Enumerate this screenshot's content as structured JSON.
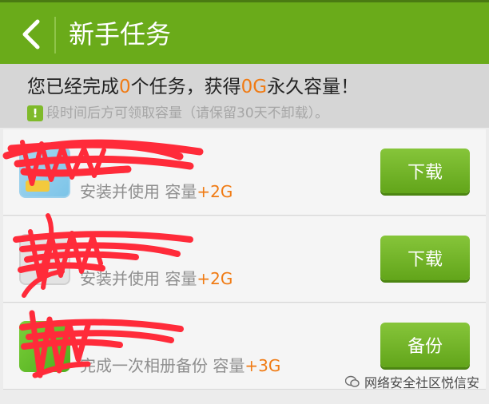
{
  "header": {
    "title": "新手任务",
    "back_icon": "chevron-left-icon"
  },
  "summary": {
    "prefix": "您已经完成",
    "completed_count": "0",
    "mid": "个任务，获得",
    "earned": "0G",
    "suffix": "永久容量！",
    "notice_icon": "!",
    "notice_text": "段时间后方可领取容量（请保留30天不卸载）。"
  },
  "tasks": [
    {
      "name": "",
      "desc": "安装并使用  容量",
      "bonus": "+2G",
      "button": "下载"
    },
    {
      "name": "",
      "desc": "安装并使用  容量",
      "bonus": "+2G",
      "button": "下载"
    },
    {
      "name": "",
      "desc": "完成一次相册备份  容量",
      "bonus": "+3G",
      "button": "备份"
    }
  ],
  "watermark": {
    "text": "网络安全社区悦信安"
  },
  "colors": {
    "header_green": "#6aab1a",
    "accent_orange": "#f07b14",
    "scribble_red": "#ff2b3a"
  }
}
